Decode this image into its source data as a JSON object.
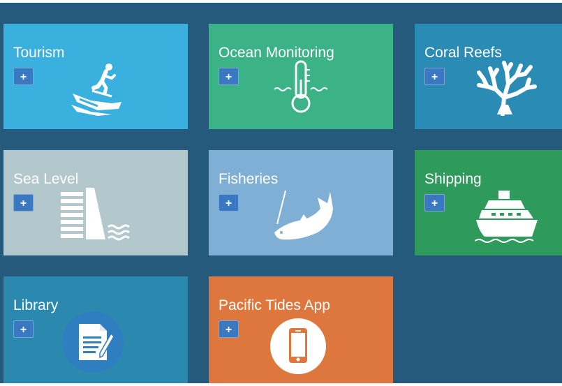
{
  "tiles": [
    {
      "title": "Tourism",
      "plus": "+",
      "icon": "water-skier-icon",
      "color": "#3ab0df"
    },
    {
      "title": "Ocean Monitoring",
      "plus": "+",
      "icon": "thermometer-waves-icon",
      "color": "#3bb386"
    },
    {
      "title": "Coral Reefs",
      "plus": "+",
      "icon": "coral-icon",
      "color": "#2a8bb4"
    },
    {
      "title": "Sea Level",
      "plus": "+",
      "icon": "seawall-icon",
      "color": "#b3c8cc"
    },
    {
      "title": "Fisheries",
      "plus": "+",
      "icon": "fish-on-line-icon",
      "color": "#80afd6"
    },
    {
      "title": "Shipping",
      "plus": "+",
      "icon": "cruise-ship-icon",
      "color": "#2e9a5b"
    },
    {
      "title": "Library",
      "plus": "+",
      "icon": "document-pen-icon",
      "color": "#2b89b0"
    },
    {
      "title": "Pacific Tides App",
      "plus": "+",
      "icon": "smartphone-icon",
      "color": "#dd773e"
    }
  ],
  "colors": {
    "background": "#255a7c",
    "plus_button": "#3a78c2"
  }
}
